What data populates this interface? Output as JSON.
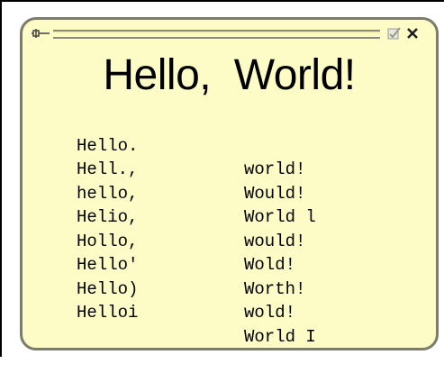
{
  "note": {
    "heading": "Hello,  World!",
    "icons": {
      "pin": "pin-icon",
      "check": "checkmark-icon",
      "close": "close-icon"
    },
    "rows": [
      {
        "left": "Hello.",
        "right": "world!"
      },
      {
        "left": "Hell.,",
        "right": "Would!"
      },
      {
        "left": "hello,",
        "right": "World l"
      },
      {
        "left": "Helio,",
        "right": "would!"
      },
      {
        "left": "Hollo,",
        "right": "Wold!"
      },
      {
        "left": "Hello'",
        "right": "Worth!"
      },
      {
        "left": "Hello)",
        "right": "wold!"
      },
      {
        "left": "Helloi",
        "right": "World I"
      }
    ],
    "colors": {
      "background": "#fdfcc6",
      "border": "#7c7c6c",
      "text": "#000000"
    }
  }
}
